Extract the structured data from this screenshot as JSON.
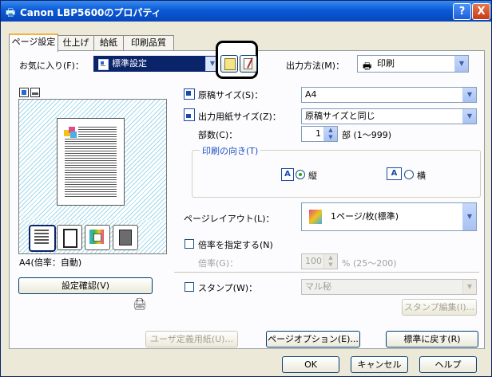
{
  "window": {
    "title": "Canon LBP5600のプロパティ",
    "help_label": "?",
    "close_label": "X"
  },
  "tabs": [
    {
      "label": "ページ設定",
      "active": true
    },
    {
      "label": "仕上げ"
    },
    {
      "label": "給紙"
    },
    {
      "label": "印刷品質"
    }
  ],
  "favorites": {
    "label": "お気に入り(F)：",
    "value": "標準設定"
  },
  "output_method": {
    "label": "出力方法(M)：",
    "value": "印刷"
  },
  "preview": {
    "caption": "A4(倍率：自動)",
    "confirm_button": "設定確認(V)"
  },
  "page_size": {
    "label": "原稿サイズ(S)：",
    "value": "A4"
  },
  "output_paper_size": {
    "label": "出力用紙サイズ(Z)：",
    "value": "原稿サイズと同じ"
  },
  "copies": {
    "label": "部数(C)：",
    "value": "1",
    "unit": "部 (1～999)"
  },
  "orientation": {
    "legend": "印刷の向き(T)",
    "portrait": "縦",
    "landscape": "横",
    "selected": "portrait"
  },
  "page_layout": {
    "label": "ページレイアウト(L)：",
    "value": "1ページ/枚(標準)"
  },
  "scaling": {
    "checkbox_label": "倍率を指定する(N)",
    "field_label": "倍率(G)：",
    "value": "100",
    "unit": "% (25～200)"
  },
  "stamp": {
    "checkbox_label": "スタンプ(W)：",
    "value": "マル秘",
    "edit_button": "スタンプ編集(I)..."
  },
  "bottom_buttons": {
    "user_paper": "ユーザ定義用紙(U)...",
    "page_options": "ページオプション(E)...",
    "restore": "標準に戻す(R)"
  },
  "dialog_buttons": {
    "ok": "OK",
    "cancel": "キャンセル",
    "help": "ヘルプ"
  },
  "colors": {
    "title_bar": "#0a5ad8",
    "tab_highlight": "#f7b13e",
    "highlight_circle": "#000000"
  }
}
